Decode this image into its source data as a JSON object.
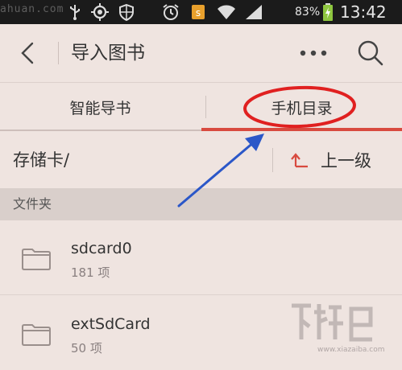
{
  "status_bar": {
    "battery_percent": "83%",
    "time": "13:42",
    "watermark_text": "ahuan.com",
    "icons": [
      "usb-icon",
      "location-icon",
      "shield-icon",
      "alarm-icon",
      "notification-icon",
      "wifi-icon",
      "signal-icon",
      "battery-charging-icon"
    ]
  },
  "header": {
    "back_icon": "back-chevron-icon",
    "title": "导入图书",
    "more_icon": "more-dots-icon",
    "search_icon": "search-icon"
  },
  "tabs": [
    {
      "label": "智能导书",
      "active": false
    },
    {
      "label": "手机目录",
      "active": true
    }
  ],
  "path_bar": {
    "path": "存储卡/",
    "up_label": "上一级",
    "up_icon": "up-arrow-icon"
  },
  "section": {
    "label": "文件夹"
  },
  "folders": [
    {
      "name": "sdcard0",
      "count": "181 项",
      "icon": "folder-icon"
    },
    {
      "name": "extSdCard",
      "count": "50 项",
      "icon": "folder-icon"
    }
  ],
  "watermark": {
    "url": "www.xiazaiba.com"
  },
  "colors": {
    "background": "#efe4e0",
    "accent": "#d84a3f",
    "annotation_red": "#e02020",
    "annotation_arrow": "#2b57c8",
    "status_bar": "#1b1b1b"
  }
}
